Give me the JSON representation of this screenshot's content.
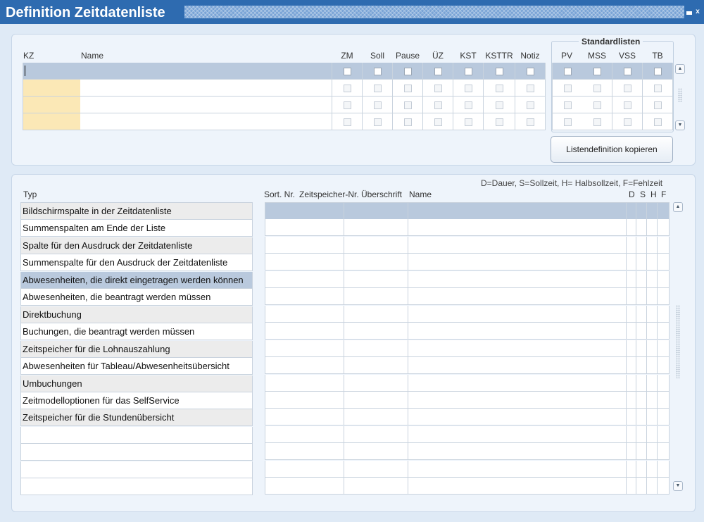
{
  "window": {
    "title": "Definition Zeitdatenliste",
    "minimize_glyph": "",
    "close_glyph": "x"
  },
  "list_definition": {
    "headers": {
      "kz": "KZ",
      "name": "Name",
      "zm": "ZM",
      "soll": "Soll",
      "pause": "Pause",
      "ueberzeit": "ÜZ",
      "kst": "KST",
      "ksttr": "KSTTR",
      "notiz": "Notiz"
    },
    "rows": [
      {
        "kz": "",
        "name": ""
      },
      {
        "kz": "",
        "name": ""
      },
      {
        "kz": "",
        "name": ""
      },
      {
        "kz": "",
        "name": ""
      }
    ],
    "standardlisten": {
      "title": "Standardlisten",
      "headers": {
        "pv": "PV",
        "mss": "MSS",
        "vss": "VSS",
        "tb": "TB"
      }
    },
    "copy_button_label": "Listendefinition kopieren"
  },
  "type_section": {
    "legend": "D=Dauer, S=Sollzeit, H= Halbsollzeit, F=Fehlzeit",
    "headers": {
      "typ": "Typ",
      "sort_nr": "Sort. Nr.",
      "zeitspeicher_nr": "Zeitspeicher-Nr.",
      "ueberschrift": "Überschrift",
      "name": "Name",
      "d": "D",
      "s": "S",
      "h": "H",
      "f": "F"
    },
    "types": [
      "Bildschirmspalte in der Zeitdatenliste",
      "Summenspalten am Ende der Liste",
      "Spalte für den Ausdruck der Zeitdatenliste",
      "Summenspalte für den Ausdruck der Zeitdatenliste",
      "Abwesenheiten, die direkt eingetragen werden können",
      "Abwesenheiten, die beantragt werden müssen",
      "Direktbuchung",
      "Buchungen, die beantragt werden müssen",
      "Zeitspeicher für die Lohnauszahlung",
      "Abwesenheiten für Tableau/Abwesenheitsübersicht",
      "Umbuchungen",
      "Zeitmodelloptionen für das SelfService",
      "Zeitspeicher für die Stundenübersicht",
      "",
      "",
      "",
      ""
    ],
    "selected_type_index": 4,
    "row_icon": "list-of-values-icon"
  },
  "colors": {
    "titlebar": "#2e6bb0",
    "selected_row": "#b9c9dd",
    "required_field": "#fbe8b6",
    "panel": "#eef4fb"
  }
}
